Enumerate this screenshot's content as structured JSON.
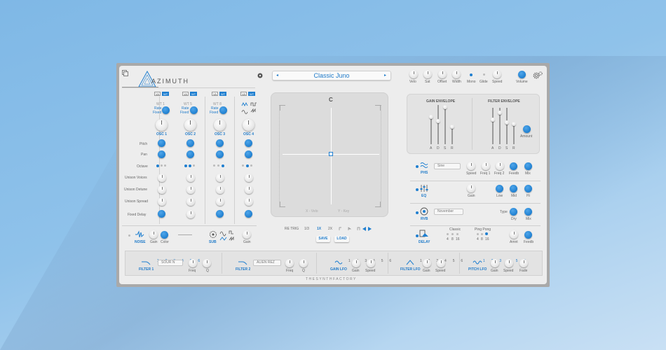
{
  "brand": {
    "name": "AZIMUTH",
    "maker": "THESYNTHFACTORY"
  },
  "preset": {
    "name": "Classic Juno",
    "prev": "◂",
    "next": "▸"
  },
  "header_knobs": [
    {
      "label": "Velo"
    },
    {
      "label": "Sat"
    },
    {
      "label": "Offset"
    },
    {
      "label": "Width"
    }
  ],
  "mono_label": "Mono",
  "glide_label": "Glide",
  "speed_label": "Speed",
  "volume_label": "Volume",
  "oscillators": [
    {
      "name": "OSC 1",
      "wt": "WT 1",
      "tags": [
        "VA",
        "WT"
      ],
      "rate": "Rate",
      "fixed": "Fixed"
    },
    {
      "name": "OSC 2",
      "wt": "",
      "tags": [
        "VA",
        "WT"
      ],
      "rate": "Rate",
      "fixed": "Fixed"
    },
    {
      "name": "OSC 3",
      "wt": "WT 8",
      "tags": [
        "VA",
        "WT"
      ],
      "rate": "Rate",
      "fixed": "Fixed"
    },
    {
      "name": "OSC 4",
      "wt": "",
      "tags": [
        "VA",
        "WT"
      ],
      "rate": "",
      "fixed": ""
    }
  ],
  "osc_params": [
    "Pitch",
    "Pan",
    "Octave",
    "Unison Voices",
    "Unison Detune",
    "Unison Spread",
    "Fixed Delay"
  ],
  "noise": {
    "name": "NOISE",
    "knobs": [
      "Gain",
      "Color"
    ]
  },
  "sub": {
    "name": "SUB",
    "knob": "Gain"
  },
  "xy_pad": {
    "x_label": "X - Velo",
    "y_label": "Y - Key",
    "reset": "C"
  },
  "retrig": {
    "label": "RE TRIG",
    "options": [
      "1/3",
      "1X",
      "2X"
    ]
  },
  "save_label": "SAVE",
  "load_label": "LOAD",
  "gain_envelope": {
    "title": "GAIN ENVELOPE",
    "labels": [
      "A",
      "D",
      "S",
      "R"
    ]
  },
  "filter_envelope": {
    "title": "FILTER ENVELOPE",
    "labels": [
      "A",
      "D",
      "S",
      "R"
    ],
    "amount": "Amount"
  },
  "phs": {
    "name": "PHS",
    "select": "Sine",
    "knobs": [
      "Speed",
      "Freq 1",
      "Freq 2",
      "Feedb",
      "Mix"
    ]
  },
  "eq": {
    "name": "EQ",
    "knobs": [
      "Gain",
      "Low",
      "Mid",
      "Hi"
    ]
  },
  "rvb": {
    "name": "RVB",
    "select": "November",
    "type_label": "Type",
    "knobs": [
      "Dry",
      "Mix"
    ]
  },
  "delay": {
    "name": "DELAY",
    "classic": "Classic",
    "ping_pong": "Ping Pong",
    "classic_vals": [
      "4",
      "8",
      "16"
    ],
    "pp_vals": [
      "4",
      "8",
      "16"
    ],
    "knobs": [
      "Amnt",
      "Feedb"
    ]
  },
  "filter1": {
    "name": "FILTER 1",
    "select": "SOUR N",
    "nums": [
      "1",
      "2",
      "3",
      "4",
      "5",
      "6"
    ],
    "knobs": [
      "Freq",
      "Q"
    ]
  },
  "filter2": {
    "name": "FILTER 2",
    "select": "ALIEN REZ",
    "knobs": [
      "Freq",
      "Q"
    ]
  },
  "gain_lfo": {
    "name": "GAIN LFO",
    "nums": [
      "1",
      "2",
      "3",
      "4",
      "5",
      "6"
    ],
    "knobs": [
      "Gain",
      "Speed"
    ]
  },
  "filter_lfo": {
    "name": "FILTER LFO",
    "nums": [
      "1",
      "2",
      "3",
      "4",
      "5",
      "6"
    ],
    "knobs": [
      "Gain",
      "Speed"
    ]
  },
  "pitch_lfo": {
    "name": "PITCH LFO",
    "nums": [
      "1",
      "2",
      "3",
      "4",
      "5",
      "6"
    ],
    "knobs": [
      "Gain",
      "Speed",
      "Fade"
    ]
  },
  "colors": {
    "accent": "#1f7fd0",
    "panel": "#ededed",
    "frame": "#a9a9a9"
  }
}
